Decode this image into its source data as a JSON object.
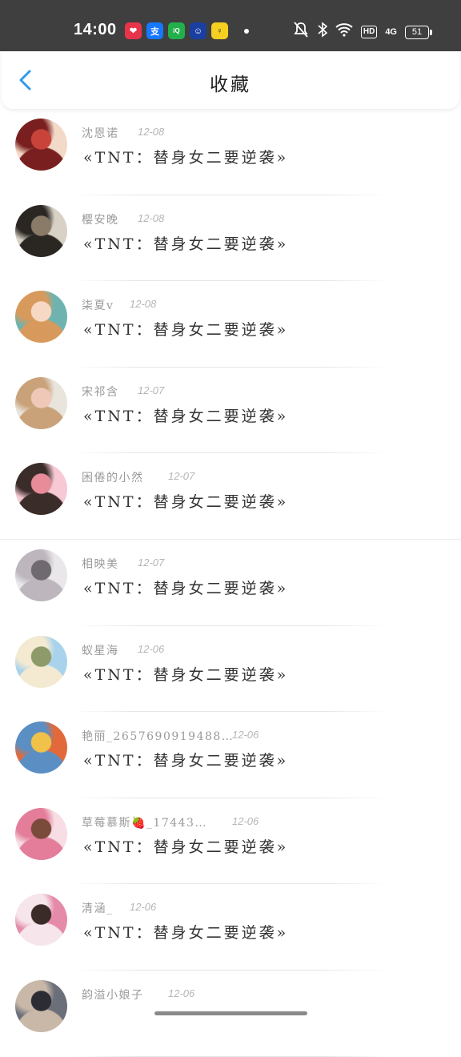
{
  "status": {
    "time": "14:00",
    "apps": [
      {
        "icon": "app-red-heart-icon",
        "text": "❤",
        "bg": "#e8344a"
      },
      {
        "icon": "alipay-icon",
        "text": "支",
        "bg": "#1677ff"
      },
      {
        "icon": "iqiyi-icon",
        "text": "iQ",
        "bg": "#22b04b"
      },
      {
        "icon": "app-blue-face-icon",
        "text": "☺",
        "bg": "#1a3fa0"
      },
      {
        "icon": "app-yellow-icon",
        "text": "♀",
        "bg": "#f5d020"
      }
    ],
    "hd": "HD",
    "network": "4G",
    "battery": "51"
  },
  "header": {
    "title": "收藏"
  },
  "items": [
    {
      "name": "沈恩诺",
      "date": "12-08",
      "book": "«TNT：替身女二要逆袭»",
      "avatar": [
        "#f3d9c8",
        "#7a1f1f",
        "#c9433a"
      ]
    },
    {
      "name": "樱安晚",
      "date": "12-08",
      "book": "«TNT：替身女二要逆袭»",
      "avatar": [
        "#d8d2c6",
        "#2a2622",
        "#8a7a68"
      ]
    },
    {
      "name": "柒夏v",
      "date": "12-08",
      "book": "«TNT：替身女二要逆袭»",
      "avatar": [
        "#6fb3b0",
        "#d89a5c",
        "#f6d8c4"
      ]
    },
    {
      "name": "宋祁含",
      "date": "12-07",
      "book": "«TNT：替身女二要逆袭»",
      "avatar": [
        "#e9e4dc",
        "#c9a27a",
        "#f0c8b8"
      ]
    },
    {
      "name": "困倦的小然",
      "date": "12-07",
      "book": "«TNT：替身女二要逆袭»",
      "avatar": [
        "#f6c9d4",
        "#3a2c28",
        "#e88c99"
      ]
    },
    {
      "name": "相映美",
      "date": "12-07",
      "book": "«TNT：替身女二要逆袭»",
      "avatar": [
        "#e9e7ea",
        "#bdb7bd",
        "#6f6a70"
      ]
    },
    {
      "name": "蚁星海",
      "date": "12-06",
      "book": "«TNT：替身女二要逆袭»",
      "avatar": [
        "#a9d3ec",
        "#f4ead2",
        "#8f9a6a"
      ]
    },
    {
      "name": "艳丽_2657690919488…",
      "date": "12-06",
      "book": "«TNT：替身女二要逆袭»",
      "avatar": [
        "#e26a3a",
        "#5b8fc4",
        "#f0c24a"
      ]
    },
    {
      "name": "草莓慕斯🍓_17443…",
      "date": "12-06",
      "book": "«TNT：替身女二要逆袭»",
      "avatar": [
        "#f7dde4",
        "#e37d9a",
        "#7a4a3a"
      ]
    },
    {
      "name": "清涵_",
      "date": "12-06",
      "book": "«TNT：替身女二要逆袭»",
      "avatar": [
        "#e58aa8",
        "#f6e6ec",
        "#3a2a28"
      ]
    },
    {
      "name": "韵溢小娘子",
      "date": "12-06",
      "book": "",
      "avatar": [
        "#6b6f7a",
        "#c9b8a8",
        "#2c2c34"
      ]
    }
  ],
  "colors": {
    "accent": "#2f9be8",
    "statusbar": "#3f3f3f"
  }
}
